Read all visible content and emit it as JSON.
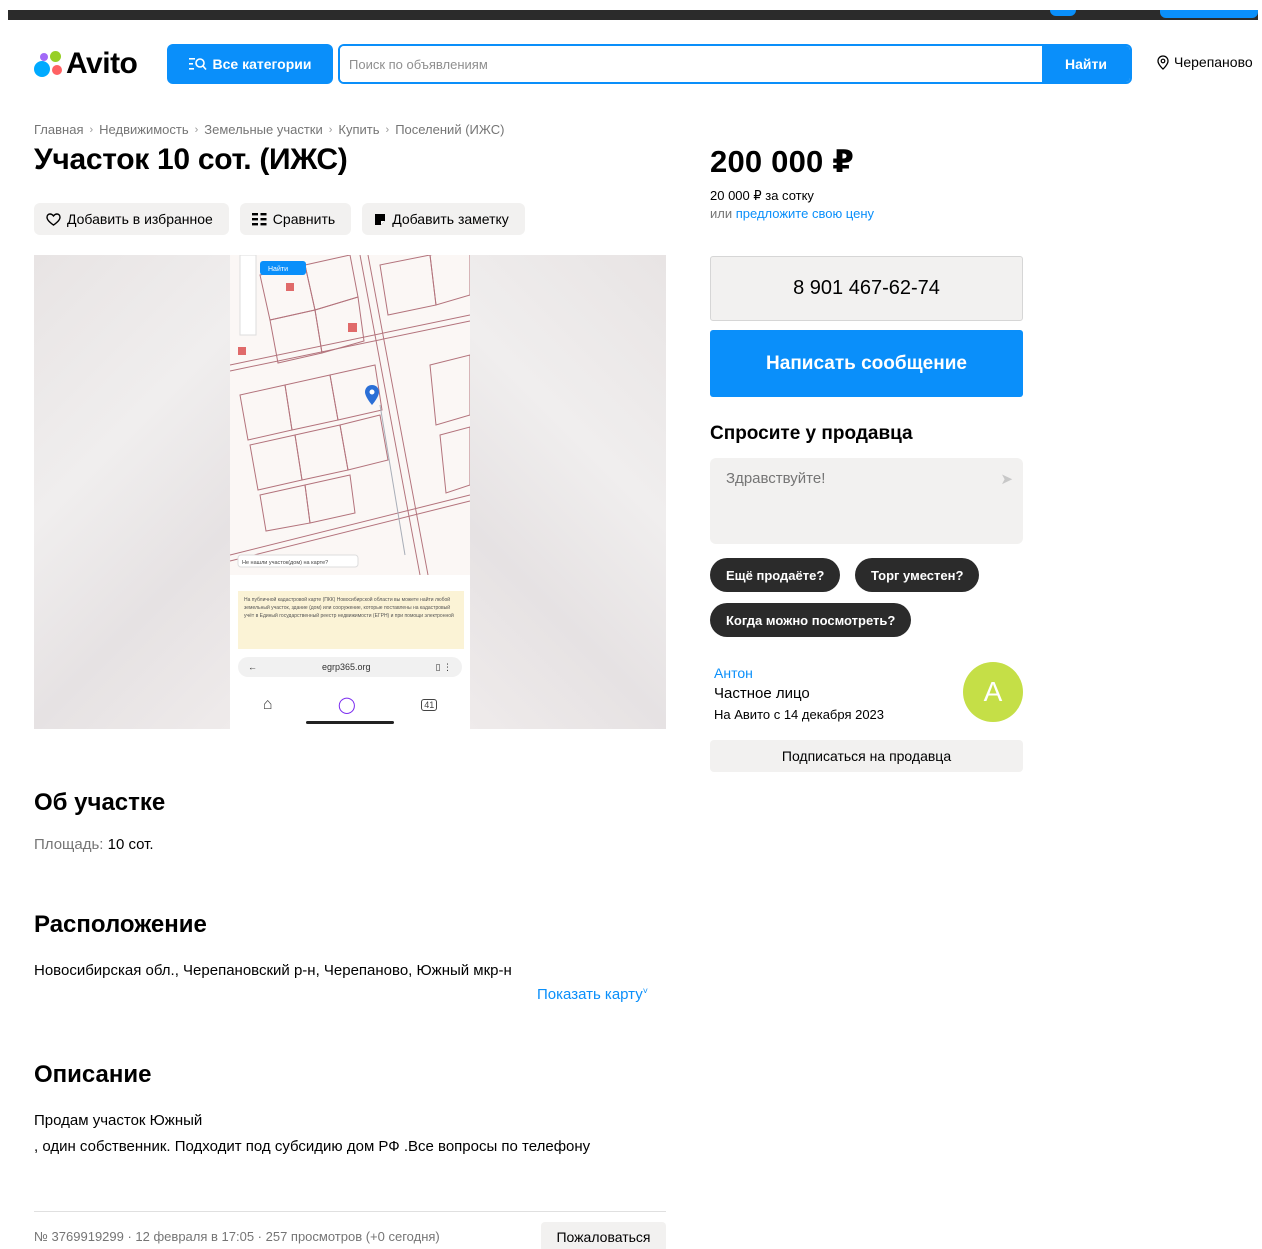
{
  "header": {
    "logo_text": "Avito",
    "categories_label": "Все категории",
    "search_placeholder": "Поиск по объявлениям",
    "search_button": "Найти",
    "location": "Черепаново"
  },
  "breadcrumbs": [
    "Главная",
    "Недвижимость",
    "Земельные участки",
    "Купить",
    "Поселений (ИЖС)"
  ],
  "listing": {
    "title": "Участок 10 сот. (ИЖС)",
    "actions": {
      "favorite": "Добавить в избранное",
      "compare": "Сравнить",
      "note": "Добавить заметку"
    }
  },
  "gallery": {
    "search_chip": "Найти",
    "map_prompt": "Не нашли участок(дом) на карте?",
    "notice_text": "На публичной кадастровой карте (ПКК) Новосибирской области вы можете найти любой земельный участок, здание (дом) или сооружение, которые поставлены на кадастровый учёт в Единый государственный реестр недвижимости (ЕГРН) и при помощи электронной",
    "browser_url": "egrp365.org",
    "tab_count": "41"
  },
  "price": {
    "amount": "200 000 ₽",
    "per_unit": "20 000 ₽ за сотку",
    "offer_prefix": "или",
    "offer_link": "предложите свою цену"
  },
  "contact": {
    "phone": "8 901 467-62-74",
    "message_button": "Написать сообщение"
  },
  "ask": {
    "title": "Спросите у продавца",
    "placeholder": "Здравствуйте!",
    "chips": [
      "Ещё продаёте?",
      "Торг уместен?",
      "Когда можно посмотреть?"
    ]
  },
  "seller": {
    "name": "Антон",
    "type": "Частное лицо",
    "since": "На Авито с 14 декабря 2023",
    "avatar_letter": "A",
    "avatar_color": "#c5df47",
    "subscribe": "Подписаться на продавца"
  },
  "about": {
    "title": "Об участке",
    "area_label": "Площадь:",
    "area_value": "10 сот."
  },
  "location_section": {
    "title": "Расположение",
    "address": "Новосибирская обл., Черепановский р-н, Черепаново, Южный мкр-н",
    "show_map": "Показать карту"
  },
  "description": {
    "title": "Описание",
    "line1": "Продам участок Южный",
    "line2": ", один собственник. Подходит под субсидию дом РФ .Все вопросы по телефону"
  },
  "footer": {
    "meta": "№ 3769919299 · 12 февраля в 17:05 · 257 просмотров (+0 сегодня)",
    "report": "Пожаловаться"
  },
  "colors": {
    "accent": "#0a8ffa",
    "chip_bg": "#2b2b2b",
    "muted_bg": "#f2f1f0"
  }
}
